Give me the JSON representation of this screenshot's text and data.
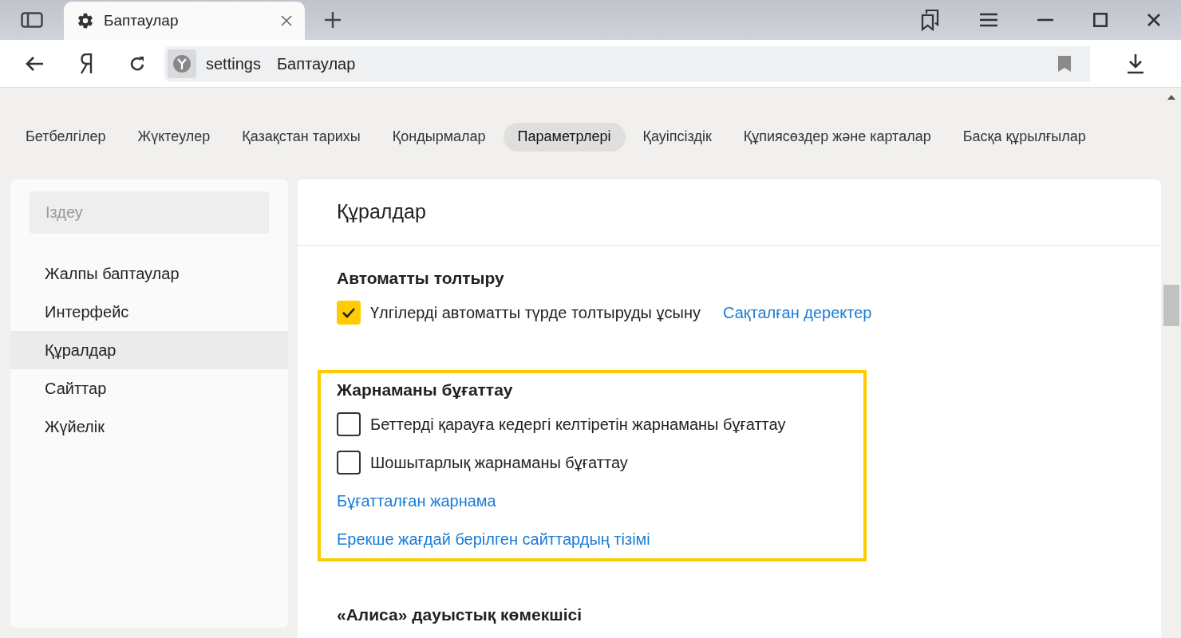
{
  "browser_tab": {
    "title": "Баптаулар"
  },
  "address_bar": {
    "scheme": "settings",
    "title": "Баптаулар"
  },
  "nav_tabs": [
    {
      "label": "Бетбелгілер",
      "selected": false
    },
    {
      "label": "Жүктеулер",
      "selected": false
    },
    {
      "label": "Қазақстан тарихы",
      "selected": false
    },
    {
      "label": "Қондырмалар",
      "selected": false
    },
    {
      "label": "Параметрлері",
      "selected": true
    },
    {
      "label": "Қауіпсіздік",
      "selected": false
    },
    {
      "label": "Құпиясөздер және карталар",
      "selected": false
    },
    {
      "label": "Басқа құрылғылар",
      "selected": false
    }
  ],
  "sidebar": {
    "search": {
      "placeholder": "Іздеу"
    },
    "items": [
      {
        "label": "Жалпы баптаулар",
        "selected": false
      },
      {
        "label": "Интерфейс",
        "selected": false
      },
      {
        "label": "Құралдар",
        "selected": true
      },
      {
        "label": "Сайттар",
        "selected": false
      },
      {
        "label": "Жүйелік",
        "selected": false
      }
    ]
  },
  "content": {
    "title": "Құралдар",
    "sections": [
      {
        "heading": "Автоматты толтыру",
        "highlighted": false,
        "items": [
          {
            "kind": "checkbox",
            "label": "Үлгілерді автоматты түрде толтыруды ұсыну",
            "checked": true,
            "link": "Сақталған деректер"
          }
        ]
      },
      {
        "heading": "Жарнаманы бұғаттау",
        "highlighted": true,
        "items": [
          {
            "kind": "checkbox",
            "label": "Беттерді қарауға кедергі келтіретін жарнаманы бұғаттау",
            "checked": false
          },
          {
            "kind": "checkbox",
            "label": "Шошытарлық жарнаманы бұғаттау",
            "checked": false
          },
          {
            "kind": "link",
            "label": "Бұғатталған жарнама"
          },
          {
            "kind": "link",
            "label": "Ерекше жағдай берілген сайттардың тізімі"
          }
        ]
      },
      {
        "heading": "«Алиса» дауыстық көмекшісі",
        "highlighted": false
      }
    ]
  }
}
